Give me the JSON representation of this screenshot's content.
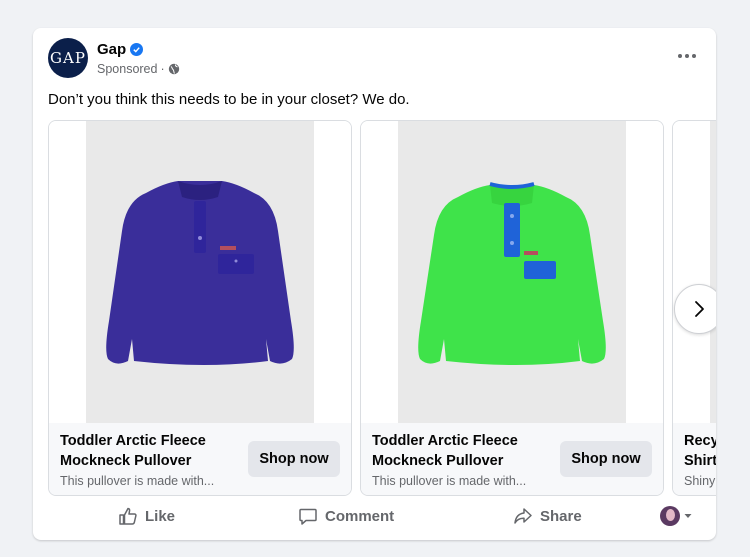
{
  "post": {
    "page_name": "Gap",
    "logo_text": "GAP",
    "sponsored_label": "Sponsored",
    "separator": "·",
    "caption": "Don’t you think this needs to be in your closet? We do."
  },
  "carousel": {
    "items": [
      {
        "title": "Toddler Arctic Fleece Mockneck Pullover",
        "description": "This pullover is made with...",
        "cta": "Shop now",
        "product_color": "#3a2e9a",
        "accent_color": "#2f259b"
      },
      {
        "title": "Toddler Arctic Fleece Mockneck Pullover",
        "description": "This pullover is made with...",
        "cta": "Shop now",
        "product_color": "#3fe34a",
        "accent_color": "#1f63d8"
      },
      {
        "title": "Recy Shirt",
        "description": "Shiny"
      }
    ],
    "next_icon": "chevron-right-icon"
  },
  "actions": {
    "like": "Like",
    "comment": "Comment",
    "share": "Share"
  },
  "colors": {
    "brand_navy": "#0b1f4a",
    "verified_blue": "#1877f2",
    "secondary_text": "#65676b"
  }
}
